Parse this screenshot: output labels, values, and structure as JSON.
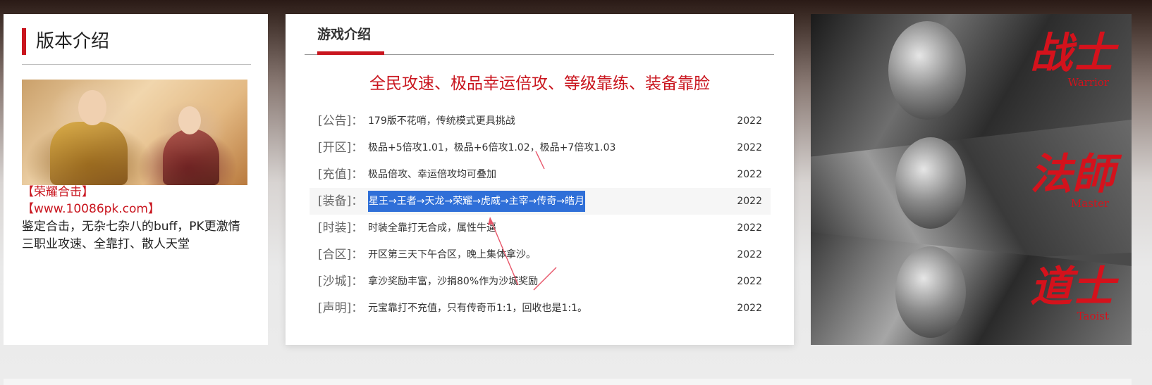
{
  "left_card": {
    "title": "版本介绍",
    "lines": [
      {
        "text": "【荣耀合击】",
        "color": "red"
      },
      {
        "text": "【www.10086pk.com】",
        "color": "red"
      },
      {
        "text": "鉴定合击，无杂七杂八的buff，PK更激情",
        "color": "dark"
      },
      {
        "text": "三职业攻速、全靠打、散人天堂",
        "color": "dark"
      }
    ]
  },
  "main_card": {
    "tab_label": "游戏介绍",
    "headline": "全民攻速、极品幸运倍攻、等级靠练、装备靠脸",
    "rows": [
      {
        "tag": "[公告]：",
        "text": "179版不花哨，传统模式更具挑战",
        "date": "2022"
      },
      {
        "tag": "[开区]：",
        "text": "极品+5倍攻1.01，极品+6倍攻1.02，极品+7倍攻1.03",
        "date": "2022"
      },
      {
        "tag": "[充值]：",
        "text": "极品倍攻、幸运倍攻均可叠加",
        "date": "2022"
      },
      {
        "tag": "[装备]：",
        "text": "星王→王者→天龙→荣耀→虎威→主宰→传奇→皓月",
        "date": "2022",
        "selected": true
      },
      {
        "tag": "[时装]：",
        "text": "时装全靠打无合成，属性牛逼",
        "date": "2022"
      },
      {
        "tag": "[合区]：",
        "text": "开区第三天下午合区，晚上集体拿沙。",
        "date": "2022"
      },
      {
        "tag": "[沙城]：",
        "text": "拿沙奖励丰富，沙捐80%作为沙城奖励",
        "date": "2022"
      },
      {
        "tag": "[声明]：",
        "text": "元宝靠打不充值，只有传奇币1:1，回收也是1:1。",
        "date": "2022"
      }
    ],
    "selection_color": "#2f6fd8",
    "accent_color": "#c9151e"
  },
  "classes_panel": {
    "classes": [
      {
        "cn": "战士",
        "en": "Warrior"
      },
      {
        "cn": "法師",
        "en": "Master"
      },
      {
        "cn": "道士",
        "en": "Taoist"
      }
    ],
    "label_color": "#d4121c"
  }
}
